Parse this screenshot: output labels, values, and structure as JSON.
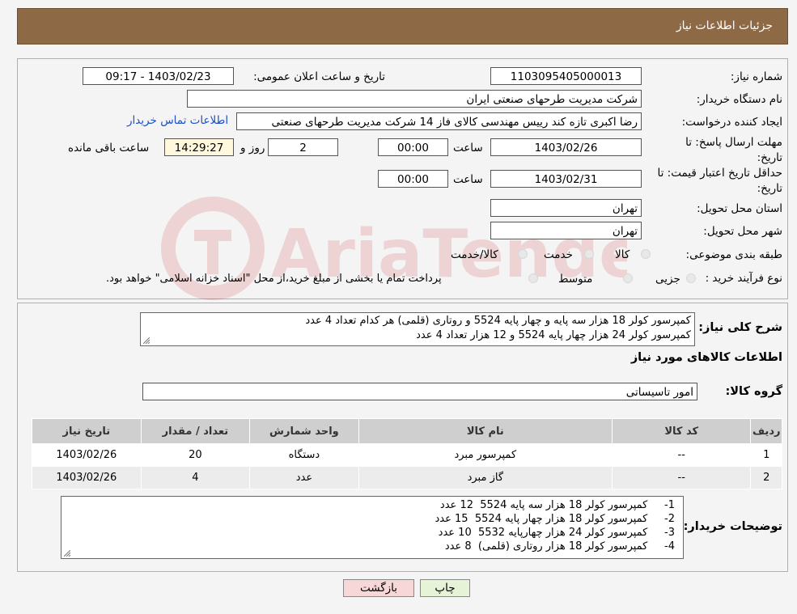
{
  "header": {
    "title": "جزئیات اطلاعات نیاز"
  },
  "form": {
    "need_number_label": "شماره نیاز:",
    "need_number": "1103095405000013",
    "announce_label": "تاریخ و ساعت اعلان عمومی:",
    "announce_value": "1403/02/23 - 09:17",
    "buyer_org_label": "نام دستگاه خریدار:",
    "buyer_org": "شرکت مدیریت طرحهای صنعتی ایران",
    "creator_label": "ایجاد کننده درخواست:",
    "creator": "رضا اکبری تازه کند رییس مهندسی کالای فاز 14 شرکت مدیریت طرحهای صنعتی",
    "contact_link": "اطلاعات تماس خریدار",
    "deadline_label": "مهلت ارسال پاسخ: تا تاریخ:",
    "deadline_date": "1403/02/26",
    "time_label": "ساعت",
    "deadline_time": "00:00",
    "days_value": "2",
    "days_label": "روز و",
    "remaining_time": "14:29:27",
    "remaining_label": "ساعت باقی مانده",
    "validity_label": "حداقل تاریخ اعتبار قیمت: تا تاریخ:",
    "validity_date": "1403/02/31",
    "validity_time": "00:00",
    "province_label": "استان محل تحویل:",
    "province": "تهران",
    "city_label": "شهر محل تحویل:",
    "city": "تهران",
    "category_label": "طبقه بندی موضوعی:",
    "category_options": [
      "کالا",
      "خدمت",
      "کالا/خدمت"
    ],
    "process_label": "نوع فرآیند خرید :",
    "process_options": [
      "جزیی",
      "متوسط"
    ],
    "process_note": "پرداخت تمام یا بخشی از مبلغ خرید،از محل \"اسناد خزانه اسلامی\" خواهد بود."
  },
  "description": {
    "label": "شرح کلی نیاز:",
    "line1": "کمپرسور کولر 18 هزار سه پایه و چهار پایه 5524 و روتاری (قلمی) هر کدام  تعداد 4 عدد",
    "line2": "کمپرسور کولر 24 هزار چهار پایه 5524  و 12 هزار تعداد 4 عدد"
  },
  "goods": {
    "section_title": "اطلاعات کالاهای مورد نیاز",
    "group_label": "گروه کالا:",
    "group_value": "امور تاسیساتی",
    "columns": [
      "ردیف",
      "کد کالا",
      "نام کالا",
      "واحد شمارش",
      "تعداد / مقدار",
      "تاریخ نیاز"
    ],
    "rows": [
      [
        "1",
        "--",
        "کمپرسور مبرد",
        "دستگاه",
        "20",
        "1403/02/26"
      ],
      [
        "2",
        "--",
        "گاز مبرد",
        "عدد",
        "4",
        "1403/02/26"
      ]
    ]
  },
  "buyer_notes": {
    "label": "توضیحات خریدار:",
    "lines": [
      "1-     کمپرسور کولر 18 هزار سه پایه 5524  12 عدد",
      "2-     کمپرسور کولر 18 هزار چهار پایه 5524  15 عدد",
      "3-     کمپرسور کولر 24 هزار چهارپایه 5532  10 عدد",
      "4-     کمپرسور کولر 18 هزار روتاری (قلمی)  8 عدد"
    ]
  },
  "buttons": {
    "print": "چاپ",
    "back": "بازگشت"
  },
  "watermark": {
    "text": "AriaTender.neT"
  },
  "colors": {
    "header_bg": "#8d6a45",
    "link": "#1a4fd0",
    "back_btn_bg": "#f7d7d7"
  }
}
